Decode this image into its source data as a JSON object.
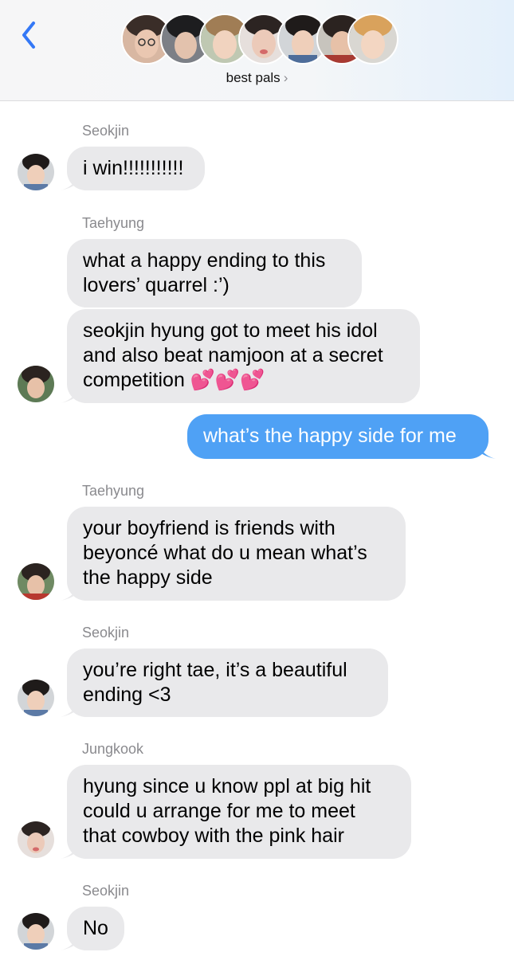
{
  "header": {
    "group_name": "best pals",
    "chevron": "›",
    "back_icon": "chevron-left-icon",
    "avatar_count": 7
  },
  "colors": {
    "accent": "#3478f6",
    "incoming_bubble": "#e9e9eb",
    "outgoing_bubble": "#4fa1f5",
    "sender_label": "#8a8a8e"
  },
  "messages": [
    {
      "sender": "Seokjin",
      "text": "i win!!!!!!!!!!!"
    },
    {
      "sender": "Taehyung",
      "text": "what a happy ending to this\nlovers’ quarrel :’)"
    },
    {
      "text": "seokjin hyung got to meet his idol\nand also beat namjoon at a secret\ncompetition 💕💕💕"
    },
    {
      "outgoing": true,
      "text": "what’s the happy side for me"
    },
    {
      "sender": "Taehyung",
      "text": "your boyfriend is friends with\nbeyoncé what do u mean what’s\nthe happy side"
    },
    {
      "sender": "Seokjin",
      "text": "you’re right tae, it’s a beautiful\nending <3"
    },
    {
      "sender": "Jungkook",
      "text": "hyung since u know ppl at big hit\ncould u arrange for me to meet\nthat cowboy with the pink hair"
    },
    {
      "sender": "Seokjin",
      "text": "No"
    }
  ]
}
